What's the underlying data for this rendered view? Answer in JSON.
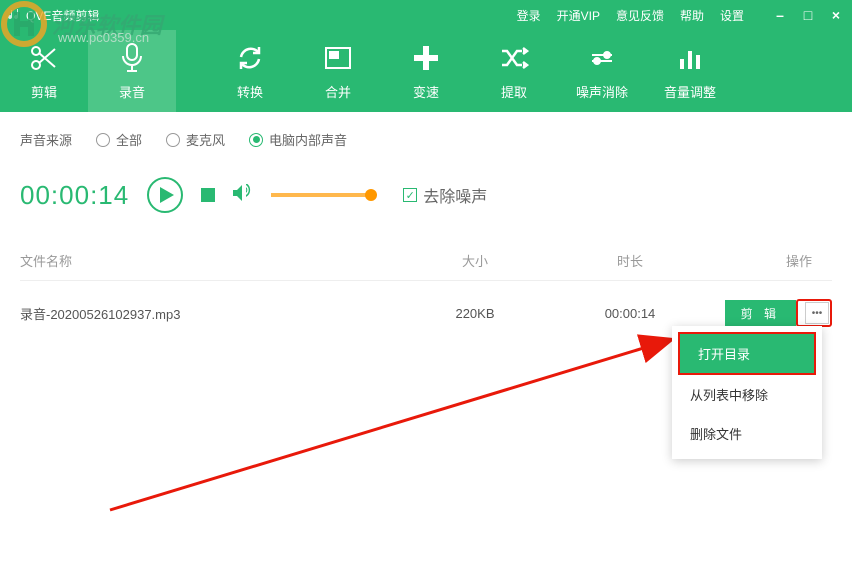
{
  "app": {
    "title": "QVE音频剪辑"
  },
  "menu": {
    "login": "登录",
    "vip": "开通VIP",
    "feedback": "意见反馈",
    "help": "帮助",
    "settings": "设置"
  },
  "tools": {
    "cut": "剪辑",
    "record": "录音",
    "convert": "转换",
    "merge": "合并",
    "speed": "变速",
    "extract": "提取",
    "noise": "噪声消除",
    "volume": "音量调整"
  },
  "source": {
    "label": "声音来源",
    "all": "全部",
    "mic": "麦克风",
    "internal": "电脑内部声音"
  },
  "controls": {
    "timer": "00:00:14",
    "denoise": "去除噪声"
  },
  "table": {
    "head": {
      "name": "文件名称",
      "size": "大小",
      "dur": "时长",
      "op": "操作"
    },
    "row": {
      "name": "录音-20200526102937.mp3",
      "size": "220KB",
      "dur": "00:00:14",
      "edit": "剪 辑"
    }
  },
  "ctx": {
    "open": "打开目录",
    "remove": "从列表中移除",
    "delete": "删除文件"
  },
  "watermark": {
    "site": "河东软件园",
    "url": "www.pc0359.cn"
  }
}
